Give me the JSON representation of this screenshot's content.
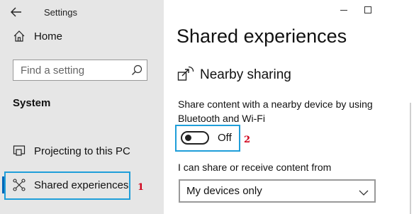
{
  "window": {
    "title": "Settings"
  },
  "sidebar": {
    "home_label": "Home",
    "search_placeholder": "Find a setting",
    "section_title": "System",
    "items": [
      {
        "label": "Projecting to this PC",
        "icon": "projecting-icon"
      },
      {
        "label": "Shared experiences",
        "icon": "shared-experiences-icon",
        "selected": true
      }
    ]
  },
  "main": {
    "page_title": "Shared experiences",
    "nearby_title": "Nearby sharing",
    "description": "Share content with a nearby device by using Bluetooth and Wi-Fi",
    "toggle_label": "Off",
    "toggle_state": false,
    "share_from_label": "I can share or receive content from",
    "share_from_selected": "My devices only"
  },
  "annotations": {
    "marker1": "1",
    "marker2": "2",
    "highlight_color": "#1f9ed9",
    "marker_color": "#d0021b"
  },
  "colors": {
    "sidebar_bg": "#e6e6e6",
    "accent": "#0067b8"
  }
}
